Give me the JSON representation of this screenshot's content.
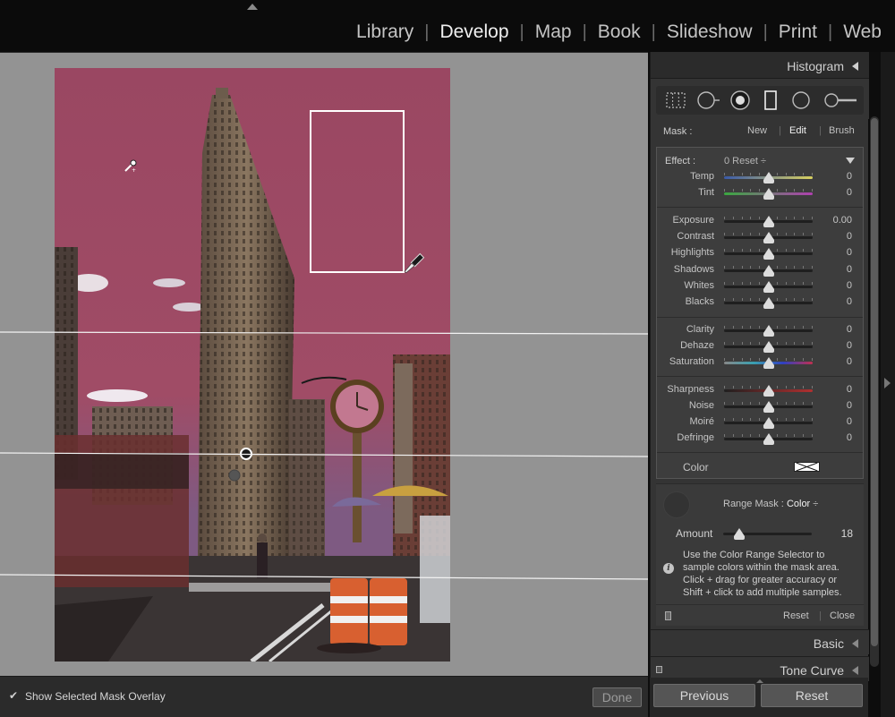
{
  "modules": [
    "Library",
    "Develop",
    "Map",
    "Book",
    "Slideshow",
    "Print",
    "Web"
  ],
  "active_module": "Develop",
  "panel": {
    "histogram_title": "Histogram",
    "tools": [
      "crop-overlay-icon",
      "spot-removal-icon",
      "red-eye-icon",
      "graduated-filter-icon",
      "radial-filter-icon",
      "adjustment-brush-icon"
    ],
    "mask": {
      "label": "Mask :",
      "new": "New",
      "edit": "Edit",
      "brush": "Brush"
    },
    "effect": {
      "label": "Effect :",
      "preset": "0 Reset ÷"
    },
    "sliders": [
      {
        "label": "Temp",
        "value": "0",
        "pos": 0.5
      },
      {
        "label": "Tint",
        "value": "0",
        "pos": 0.5
      },
      {
        "label": "Exposure",
        "value": "0.00",
        "pos": 0.5
      },
      {
        "label": "Contrast",
        "value": "0",
        "pos": 0.5
      },
      {
        "label": "Highlights",
        "value": "0",
        "pos": 0.5
      },
      {
        "label": "Shadows",
        "value": "0",
        "pos": 0.5
      },
      {
        "label": "Whites",
        "value": "0",
        "pos": 0.5
      },
      {
        "label": "Blacks",
        "value": "0",
        "pos": 0.5
      },
      {
        "label": "Clarity",
        "value": "0",
        "pos": 0.5
      },
      {
        "label": "Dehaze",
        "value": "0",
        "pos": 0.5
      },
      {
        "label": "Saturation",
        "value": "0",
        "pos": 0.5
      },
      {
        "label": "Sharpness",
        "value": "0",
        "pos": 0.5
      },
      {
        "label": "Noise",
        "value": "0",
        "pos": 0.5
      },
      {
        "label": "Moiré",
        "value": "0",
        "pos": 0.5
      },
      {
        "label": "Defringe",
        "value": "0",
        "pos": 0.5
      }
    ],
    "color_label": "Color",
    "range_mask": {
      "label": "Range Mask :",
      "value": "Color",
      "arrows": "÷"
    },
    "amount": {
      "label": "Amount",
      "value": "18",
      "pos": 0.18
    },
    "help_text": "Use the Color Range Selector to sample colors within the mask area. Click + drag for greater accuracy or Shift + click to add multiple samples.",
    "footer": {
      "reset": "Reset",
      "close": "Close"
    },
    "basic_title": "Basic",
    "tonecurve_title": "Tone Curve",
    "previous_label": "Previous",
    "reset_label": "Reset"
  },
  "toolbar": {
    "overlay_check": "✔",
    "overlay_label": "Show Selected Mask Overlay",
    "done_label": "Done"
  },
  "colors": {
    "mask_overlay": "#9b4a63",
    "accent_text": "#f0f0f0"
  }
}
